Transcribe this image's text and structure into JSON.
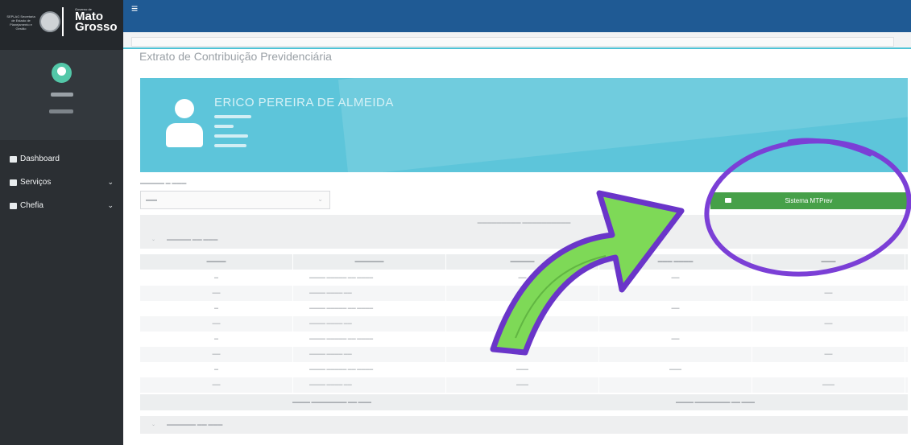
{
  "logo": {
    "left_text": "SEPLAG Secretaria de Estado de Planejamento e Gestão",
    "gov_small": "Governo de",
    "brand_line1": "Mato",
    "brand_line2": "Grosso"
  },
  "sidebar": {
    "items": [
      {
        "label": "Dashboard",
        "icon": "home-icon"
      },
      {
        "label": "Serviços",
        "icon": "briefcase-icon"
      },
      {
        "label": "Chefia",
        "icon": "briefcase-icon"
      }
    ]
  },
  "header": {
    "page_title": "Extrato de Contribuição Previdenciária"
  },
  "employee": {
    "name": "ERICO PEREIRA DE ALMEIDA"
  },
  "actions": {
    "mtprev_label": "Sistema MTPrev"
  },
  "colors": {
    "topbar": "#1f5a94",
    "banner": "#5dc5da",
    "button": "#46a049",
    "annotation": "#7b3fd6",
    "arrow": "#7ed957"
  }
}
